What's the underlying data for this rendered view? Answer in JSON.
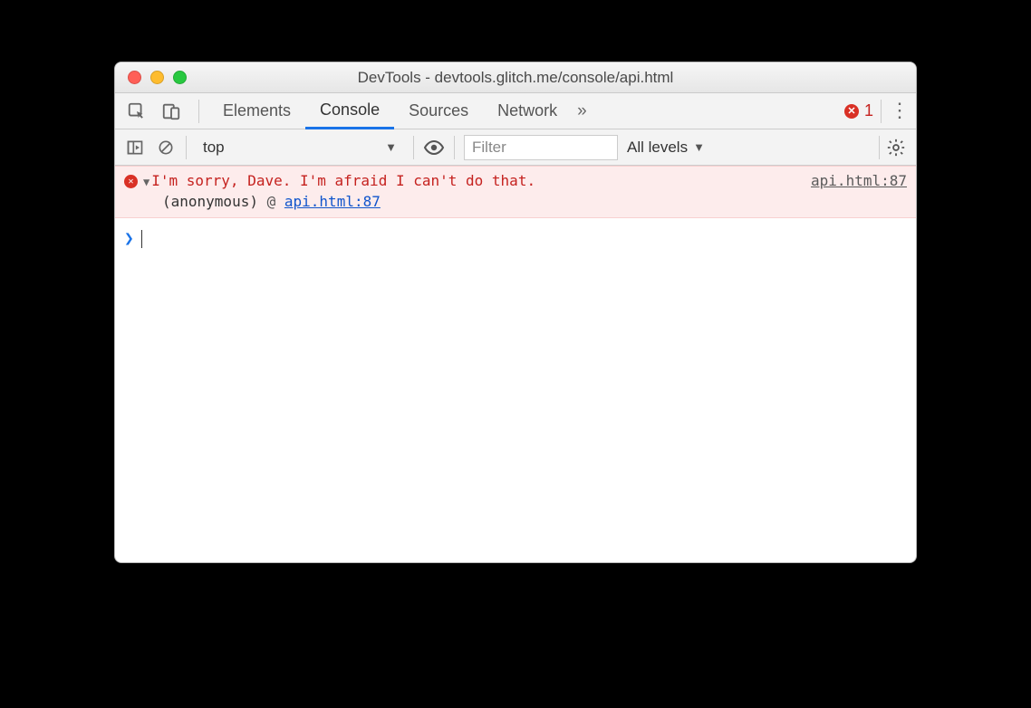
{
  "window": {
    "title": "DevTools - devtools.glitch.me/console/api.html"
  },
  "tabs": {
    "items": [
      "Elements",
      "Console",
      "Sources",
      "Network"
    ],
    "active_index": 1,
    "overflow_glyph": "»"
  },
  "error_badge": {
    "count": "1"
  },
  "filterbar": {
    "context": "top",
    "filter_placeholder": "Filter",
    "levels_label": "All levels"
  },
  "console": {
    "error": {
      "message": "I'm sorry, Dave. I'm afraid I can't do that.",
      "source": "api.html:87",
      "stack_label": "(anonymous)",
      "stack_at": "@",
      "stack_link": "api.html:87"
    },
    "prompt_glyph": "›"
  }
}
